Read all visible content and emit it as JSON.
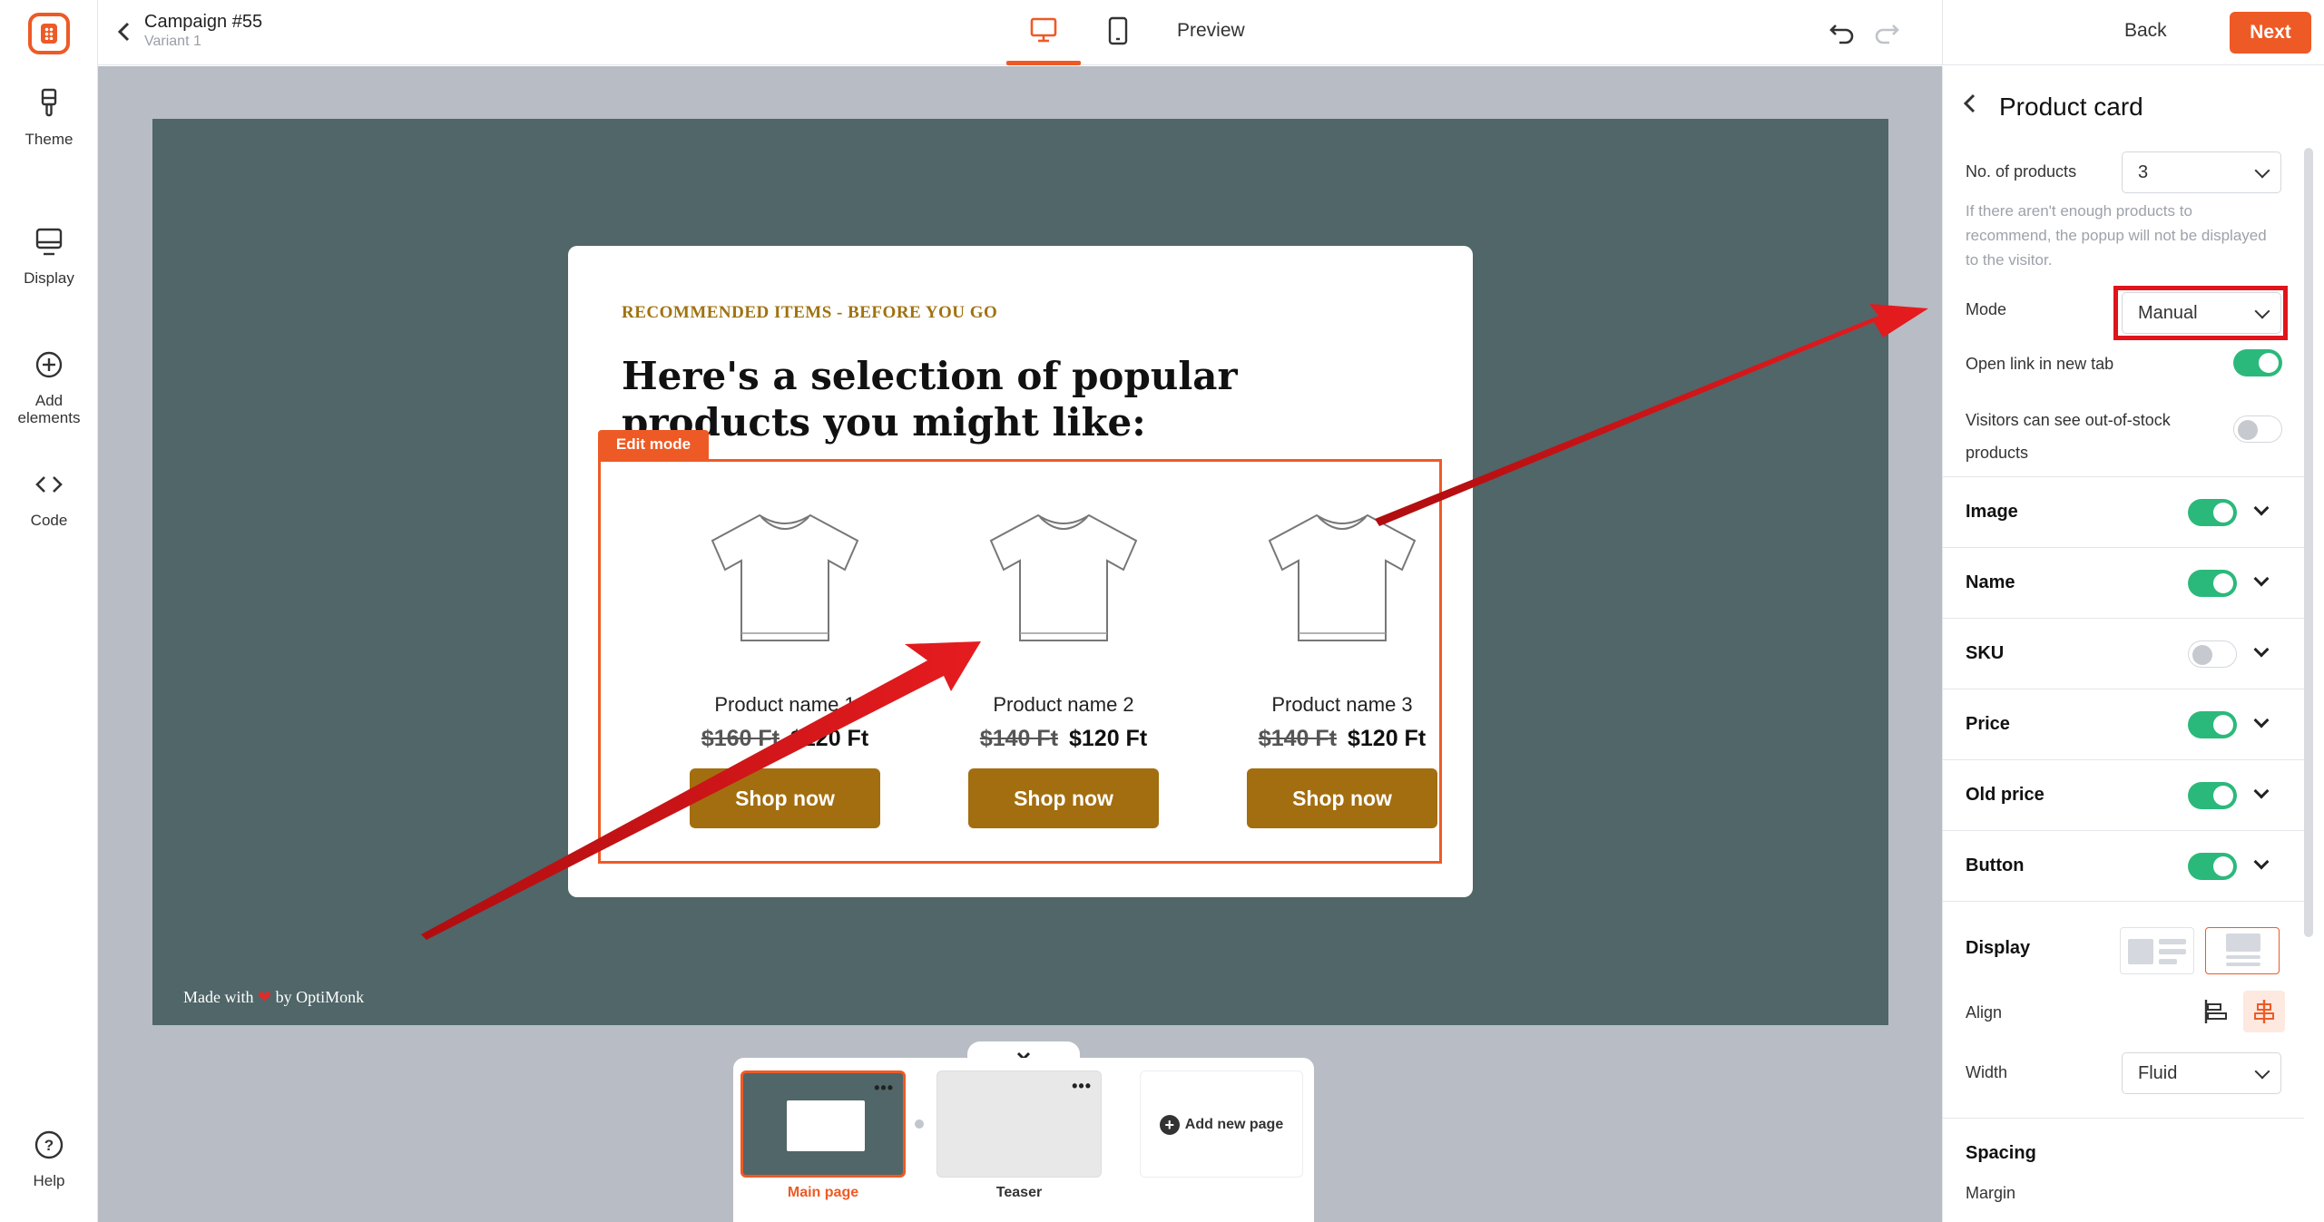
{
  "sidebar": {
    "items": [
      {
        "label": "Theme",
        "icon": "brush-icon"
      },
      {
        "label": "Display",
        "icon": "monitor-icon"
      },
      {
        "label": "Add elements",
        "icon": "plus-circle-icon"
      },
      {
        "label": "Code",
        "icon": "code-icon"
      }
    ],
    "help_label": "Help"
  },
  "header": {
    "campaign": "Campaign #55",
    "variant": "Variant 1",
    "preview_label": "Preview",
    "back_label": "Back",
    "next_label": "Next"
  },
  "canvas": {
    "made_with_prefix": "Made with",
    "made_with_suffix": "by OptiMonk",
    "popup": {
      "eyebrow": "RECOMMENDED ITEMS - BEFORE YOU GO",
      "heading": "Here's a selection of popular products you might like:",
      "edit_tag": "Edit mode",
      "products": [
        {
          "name": "Product name 1",
          "old_price": "$160 Ft",
          "price": "$120 Ft",
          "button": "Shop now"
        },
        {
          "name": "Product name 2",
          "old_price": "$140 Ft",
          "price": "$120 Ft",
          "button": "Shop now"
        },
        {
          "name": "Product name 3",
          "old_price": "$140 Ft",
          "price": "$120 Ft",
          "button": "Shop now"
        }
      ]
    }
  },
  "pages": {
    "items": [
      {
        "label": "Main page",
        "active": true
      },
      {
        "label": "Teaser",
        "active": false
      }
    ],
    "add_label": "Add new page"
  },
  "panel": {
    "title": "Product card",
    "no_of_products_label": "No. of products",
    "no_of_products_value": "3",
    "hint": "If there aren't enough products to recommend, the popup will not be displayed to the visitor.",
    "mode_label": "Mode",
    "mode_value": "Manual",
    "open_link_label": "Open link in new tab",
    "open_link_on": true,
    "out_of_stock_label": "Visitors can see out-of-stock products",
    "out_of_stock_on": false,
    "sections": [
      {
        "title": "Image",
        "on": true
      },
      {
        "title": "Name",
        "on": true
      },
      {
        "title": "SKU",
        "on": false
      },
      {
        "title": "Price",
        "on": true
      },
      {
        "title": "Old price",
        "on": true
      },
      {
        "title": "Button",
        "on": true
      }
    ],
    "display_label": "Display",
    "align_label": "Align",
    "width_label": "Width",
    "width_value": "Fluid",
    "spacing_label": "Spacing",
    "margin_label": "Margin"
  },
  "colors": {
    "accent": "#ee5a25",
    "toggle_on": "#2bb97b",
    "shop_button": "#a36e0f",
    "stage": "#506669",
    "annotation": "#e0141a"
  }
}
